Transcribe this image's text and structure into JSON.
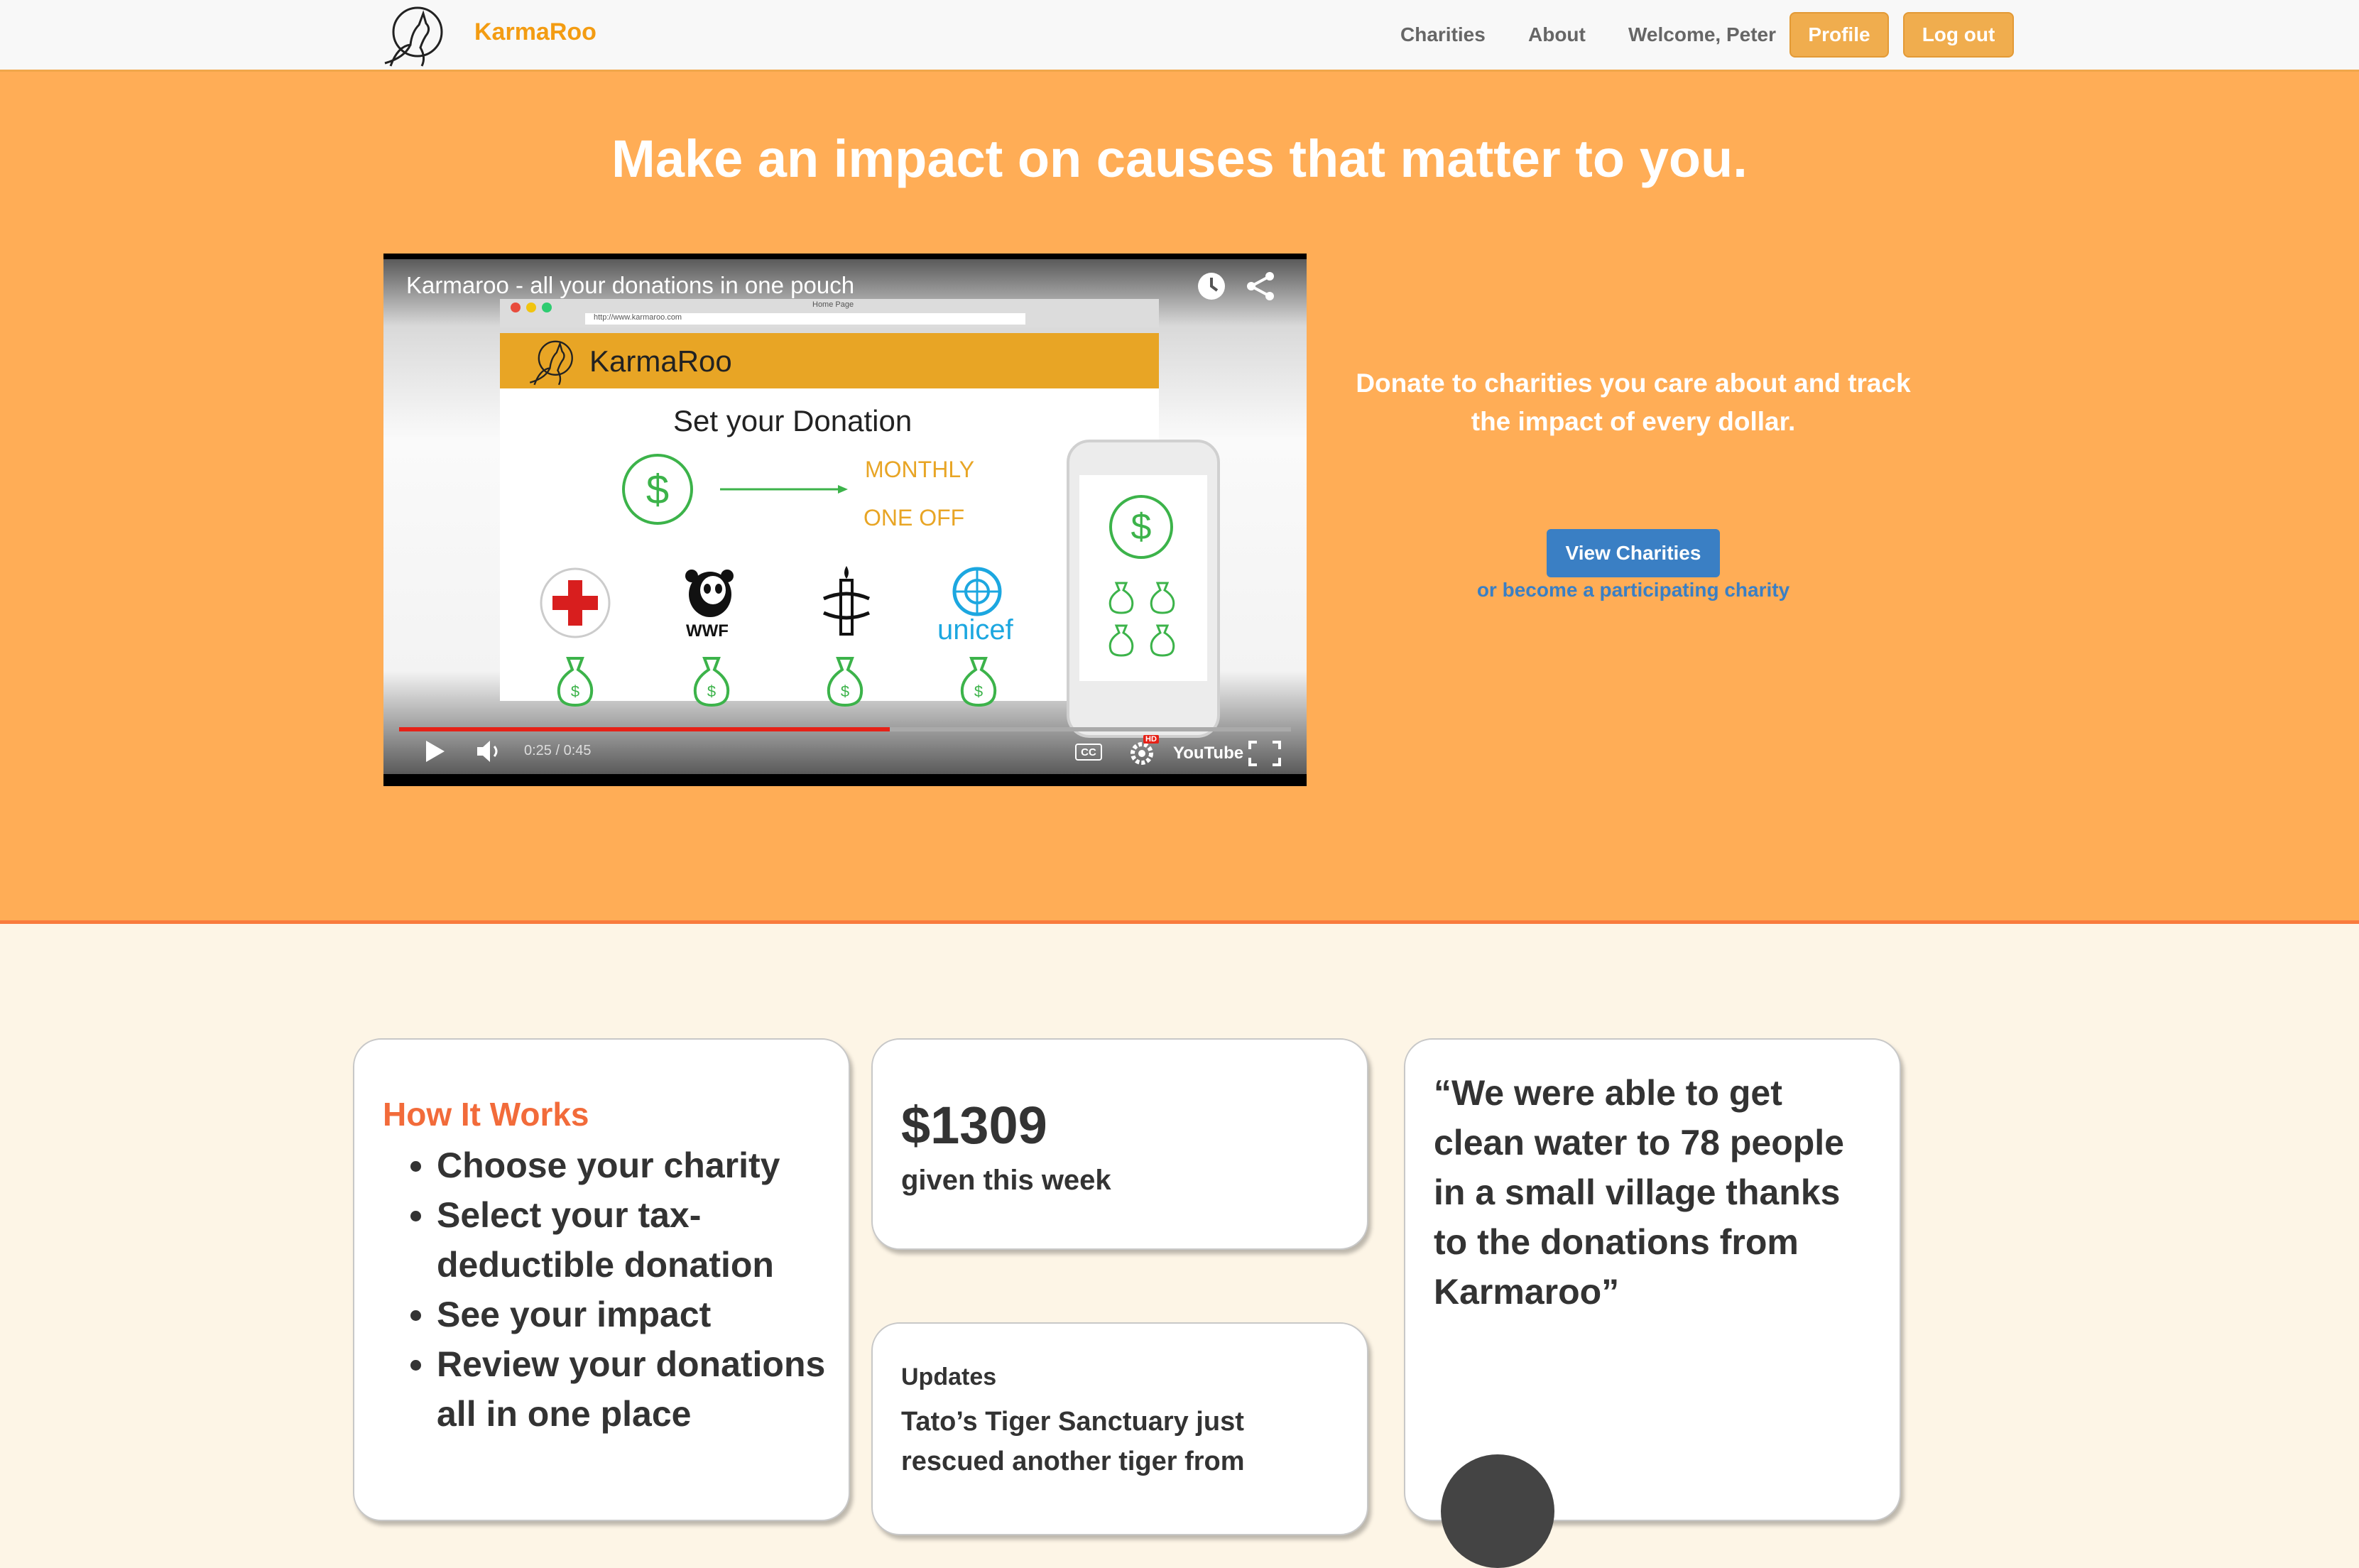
{
  "nav": {
    "brand": "KarmaRoo",
    "links": [
      "Charities",
      "About",
      "Welcome, Peter"
    ],
    "profile_label": "Profile",
    "logout_label": "Log out"
  },
  "hero": {
    "title": "Make an impact on causes that matter to you.",
    "tagline": "Donate to charities you care about and track the impact of every dollar.",
    "view_button": "View Charities",
    "become_link": "or become a participating charity"
  },
  "video": {
    "title": "Karmaroo - all your donations in one pouch",
    "mock_brand": "KarmaRoo",
    "heading": "Set your Donation",
    "option_monthly": "MONTHLY",
    "option_oneoff": "ONE OFF",
    "charities": [
      "red-cross-logo",
      "wwf-logo",
      "amnesty-logo",
      "unicef-logo"
    ],
    "wwf_text": "WWF",
    "unicef_text": "unicef",
    "dollar_sign": "$",
    "time": "0:25 / 0:45",
    "progress": 0.55,
    "cc_label": "CC",
    "hd_label": "HD",
    "youtube_label": "YouTube",
    "url_text": "http://www.karmaroo.com",
    "page_label": "Home Page"
  },
  "how_it_works": {
    "title": "How It Works",
    "items": [
      "Choose your charity",
      "Select your tax-deductible donation",
      "See your impact",
      "Review your donations all in one place"
    ]
  },
  "stats": {
    "amount": "$1309",
    "label": "given this week"
  },
  "updates": {
    "title": "Updates",
    "text": "Tato’s Tiger Sanctuary just rescued another tiger from"
  },
  "testimonial": {
    "quote": "“We were able to get clean water to 78 people in a small village thanks to the donations from Karmaroo”"
  },
  "colors": {
    "accent": "#f0ad4e",
    "hero_bg": "#ffad56",
    "title_orange": "#f26b3a",
    "link_blue": "#3a7fc4",
    "page_bg": "#fdf5e6"
  }
}
